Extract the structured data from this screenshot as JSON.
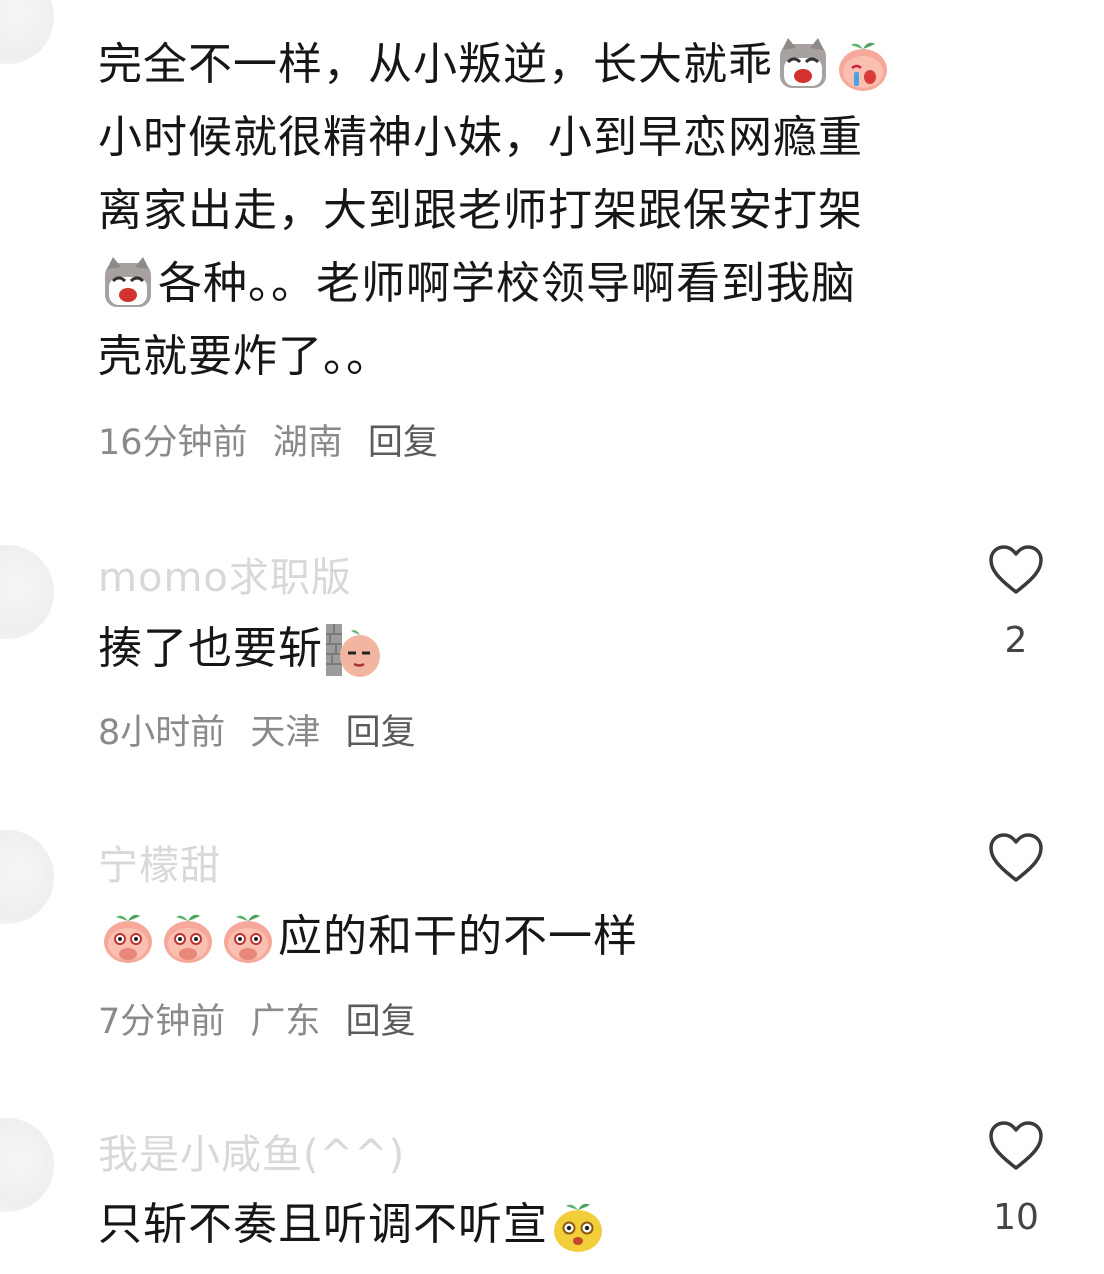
{
  "comments": [
    {
      "username": "",
      "lines": [
        "完全不一样，从小叛逆，长大就乖",
        "小时候就很精神小妹，小到早恋网瘾重",
        "离家出走，大到跟老师打架跟保安打架",
        "各种。。老师啊学校领导啊看到我脑",
        "壳就要炸了。。"
      ],
      "stickers": [
        "cat-crying-sticker",
        "peach-crying-sticker",
        "cat-crying-sticker"
      ],
      "time": "16分钟前",
      "location": "湖南",
      "reply": "回复",
      "likes": ""
    },
    {
      "username": "momo求职版",
      "lines": [
        "揍了也要斩"
      ],
      "stickers": [
        "peach-peeking-wall-sticker"
      ],
      "time": "8小时前",
      "location": "天津",
      "reply": "回复",
      "likes": "2"
    },
    {
      "username": "宁檬甜",
      "lines": [
        "应的和干的不一样"
      ],
      "stickers": [
        "peach-covering-mouth-sticker",
        "peach-covering-mouth-sticker",
        "peach-covering-mouth-sticker"
      ],
      "time": "7分钟前",
      "location": "广东",
      "reply": "回复",
      "likes": ""
    },
    {
      "username": "我是小咸鱼(^^)",
      "lines": [
        "只斩不奏且听调不听宣"
      ],
      "stickers": [
        "yellow-peach-shocked-sticker"
      ],
      "time": "",
      "location": "",
      "reply": "",
      "likes": "10"
    }
  ],
  "colors": {
    "text": "#161616",
    "meta": "#8a8a8e",
    "username": "#b9b9bd",
    "heart": "#3a3a3c"
  },
  "icons": {
    "like": "heart-outline-icon"
  }
}
